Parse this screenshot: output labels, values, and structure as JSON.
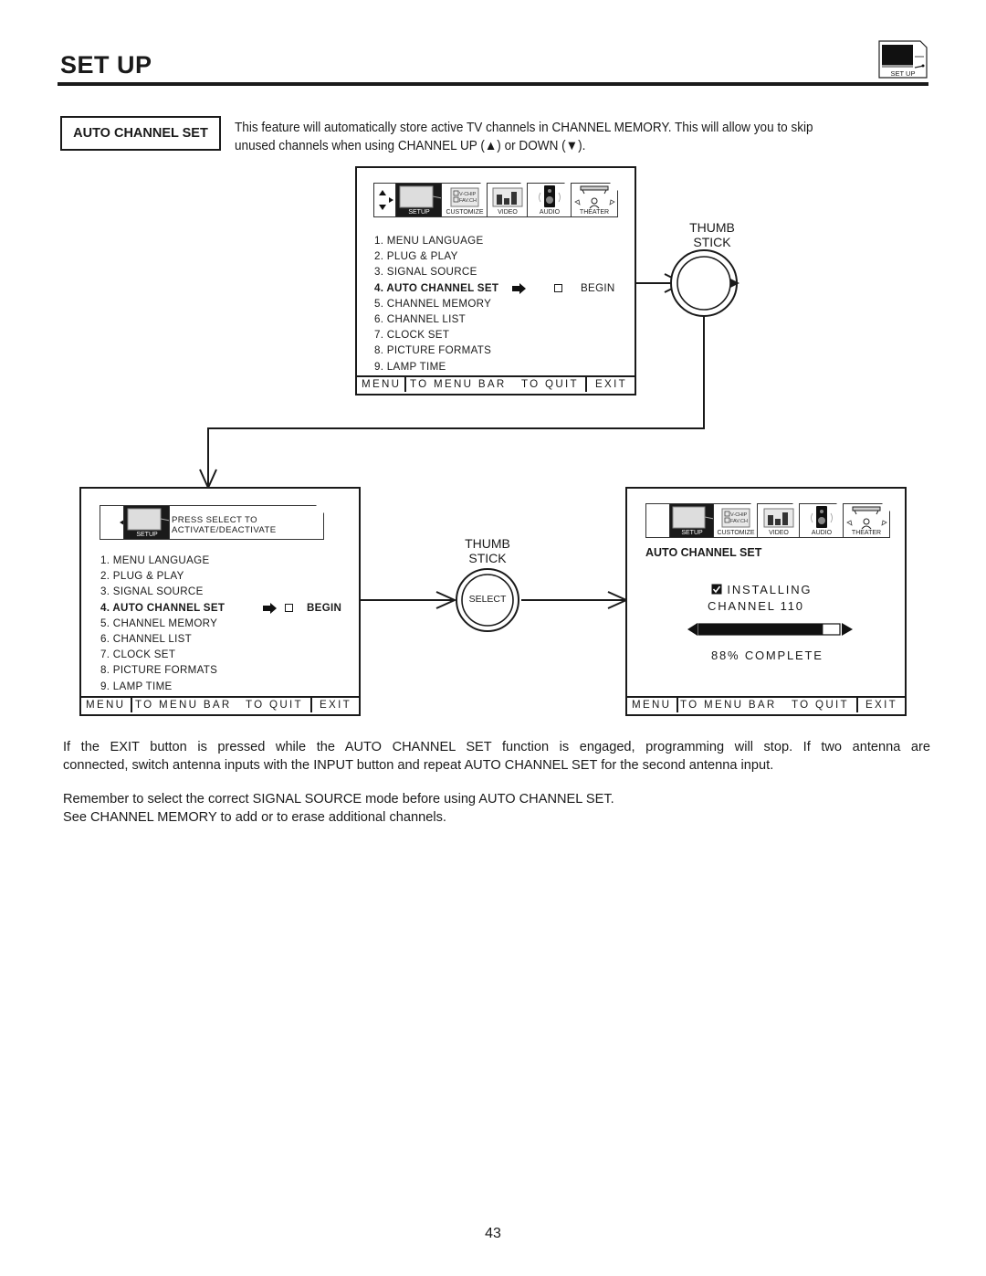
{
  "header": {
    "title": "SET UP",
    "badge_label": "SET UP",
    "badge_icon": "tv-setup-icon"
  },
  "section": {
    "label": "AUTO CHANNEL SET",
    "intro_line1": "This feature will automatically store active TV channels in CHANNEL MEMORY.  This will allow you to skip",
    "intro_line2": "unused channels when using CHANNEL UP (▲) or DOWN (▼)."
  },
  "tabs": [
    {
      "label": "SETUP",
      "icon": "tv-screen-icon",
      "active": true
    },
    {
      "label": "CUSTOMIZE",
      "icon": "vchip-favch-icon",
      "active": false,
      "lines": [
        "V-CHIP",
        "FAV.CH"
      ]
    },
    {
      "label": "VIDEO",
      "icon": "bar-graph-icon",
      "active": false
    },
    {
      "label": "AUDIO",
      "icon": "speaker-icon",
      "active": false
    },
    {
      "label": "THEATER",
      "icon": "theater-icon",
      "active": false
    }
  ],
  "menu": {
    "items": [
      "1. MENU LANGUAGE",
      "2. PLUG & PLAY",
      "3. SIGNAL SOURCE",
      "4. AUTO CHANNEL SET",
      "5. CHANNEL MEMORY",
      "6. CHANNEL LIST",
      "7. CLOCK SET",
      "8. PICTURE FORMATS",
      "9. LAMP TIME"
    ],
    "selected_index": 3,
    "begin_label": "BEGIN"
  },
  "footer": {
    "menu": "MENU",
    "to_menu_bar": "TO MENU BAR",
    "to_quit": "TO QUIT",
    "exit": "EXIT"
  },
  "screen2": {
    "hint_line1": "PRESS SELECT TO",
    "hint_line2": "ACTIVATE/DEACTIVATE",
    "tab_label": "SETUP"
  },
  "thumbstick": {
    "label_line1": "THUMB",
    "label_line2": "STICK",
    "select_label": "SELECT"
  },
  "screen3": {
    "heading": "AUTO CHANNEL SET",
    "status": "INSTALLING",
    "channel": "CHANNEL 110",
    "progress_percent": 88,
    "progress_text": "88% COMPLETE"
  },
  "body": {
    "para1_line1": "If the EXIT button is pressed while the AUTO CHANNEL SET function is engaged, programming will stop.  If two antenna are",
    "para1_line2": "connected, switch antenna inputs with the INPUT button and repeat AUTO CHANNEL SET for the second antenna input.",
    "para2_line1": "Remember to select the correct SIGNAL SOURCE mode before using AUTO CHANNEL SET.",
    "para2_line2": "See CHANNEL MEMORY to add or to erase additional channels."
  },
  "page_number": "43"
}
